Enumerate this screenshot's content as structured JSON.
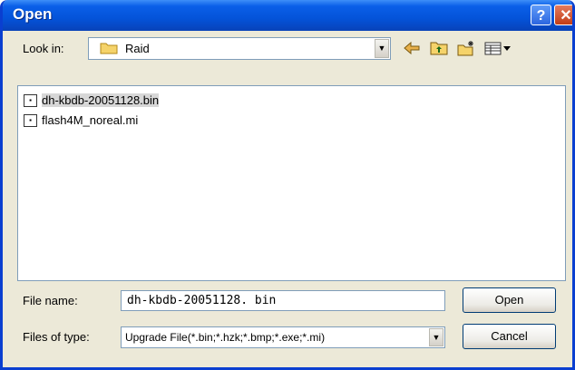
{
  "window": {
    "title": "Open"
  },
  "titlebar": {
    "help_label": "?",
    "close_label": "✕"
  },
  "lookin": {
    "label": "Look in:",
    "value": "Raid",
    "arrow": "▼"
  },
  "files": [
    {
      "name": "dh-kbdb-20051128.bin",
      "selected": true
    },
    {
      "name": "flash4M_noreal.mi",
      "selected": false
    }
  ],
  "filename": {
    "label": "File name:",
    "value": "dh-kbdb-20051128. bin"
  },
  "filetype": {
    "label": "Files of type:",
    "value": "Upgrade File(*.bin;*.hzk;*.bmp;*.exe;*.mi)",
    "arrow": "▼"
  },
  "buttons": {
    "open": "Open",
    "cancel": "Cancel"
  },
  "icons": {
    "back": "back-arrow-icon",
    "up": "up-folder-icon",
    "new": "new-folder-icon",
    "view": "view-menu-icon"
  }
}
